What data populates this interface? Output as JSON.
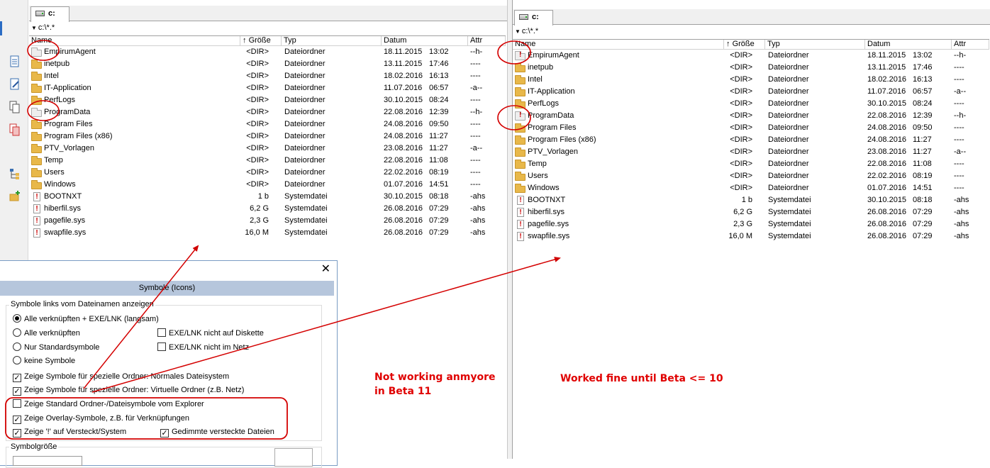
{
  "left_panel": {
    "tab_label": "c:",
    "path": "c:\\*.*",
    "columns": {
      "name": "Name",
      "size": "Größe",
      "type": "Typ",
      "date": "Datum",
      "attr": "Attr"
    },
    "rows": [
      {
        "icon": "folder-plain",
        "name": "EmpirumAgent",
        "size": "<DIR>",
        "type": "Dateiordner",
        "date": "18.11.2015",
        "time": "13:02",
        "attr": "--h-"
      },
      {
        "icon": "folder",
        "name": "inetpub",
        "size": "<DIR>",
        "type": "Dateiordner",
        "date": "13.11.2015",
        "time": "17:46",
        "attr": "----"
      },
      {
        "icon": "folder",
        "name": "Intel",
        "size": "<DIR>",
        "type": "Dateiordner",
        "date": "18.02.2016",
        "time": "16:13",
        "attr": "----"
      },
      {
        "icon": "folder",
        "name": "IT-Application",
        "size": "<DIR>",
        "type": "Dateiordner",
        "date": "11.07.2016",
        "time": "06:57",
        "attr": "-a--"
      },
      {
        "icon": "folder",
        "name": "PerfLogs",
        "size": "<DIR>",
        "type": "Dateiordner",
        "date": "30.10.2015",
        "time": "08:24",
        "attr": "----"
      },
      {
        "icon": "folder-plain",
        "name": "ProgramData",
        "size": "<DIR>",
        "type": "Dateiordner",
        "date": "22.08.2016",
        "time": "12:39",
        "attr": "--h-"
      },
      {
        "icon": "folder",
        "name": "Program Files",
        "size": "<DIR>",
        "type": "Dateiordner",
        "date": "24.08.2016",
        "time": "09:50",
        "attr": "----"
      },
      {
        "icon": "folder",
        "name": "Program Files (x86)",
        "size": "<DIR>",
        "type": "Dateiordner",
        "date": "24.08.2016",
        "time": "11:27",
        "attr": "----"
      },
      {
        "icon": "folder",
        "name": "PTV_Vorlagen",
        "size": "<DIR>",
        "type": "Dateiordner",
        "date": "23.08.2016",
        "time": "11:27",
        "attr": "-a--"
      },
      {
        "icon": "folder",
        "name": "Temp",
        "size": "<DIR>",
        "type": "Dateiordner",
        "date": "22.08.2016",
        "time": "11:08",
        "attr": "----"
      },
      {
        "icon": "folder",
        "name": "Users",
        "size": "<DIR>",
        "type": "Dateiordner",
        "date": "22.02.2016",
        "time": "08:19",
        "attr": "----"
      },
      {
        "icon": "folder",
        "name": "Windows",
        "size": "<DIR>",
        "type": "Dateiordner",
        "date": "01.07.2016",
        "time": "14:51",
        "attr": "----"
      },
      {
        "icon": "sysfile",
        "name": "BOOTNXT",
        "size": "1 b",
        "type": "Systemdatei",
        "date": "30.10.2015",
        "time": "08:18",
        "attr": "-ahs"
      },
      {
        "icon": "sysfile",
        "name": "hiberfil.sys",
        "size": "6,2 G",
        "type": "Systemdatei",
        "date": "26.08.2016",
        "time": "07:29",
        "attr": "-ahs"
      },
      {
        "icon": "sysfile",
        "name": "pagefile.sys",
        "size": "2,3 G",
        "type": "Systemdatei",
        "date": "26.08.2016",
        "time": "07:29",
        "attr": "-ahs"
      },
      {
        "icon": "sysfile",
        "name": "swapfile.sys",
        "size": "16,0 M",
        "type": "Systemdatei",
        "date": "26.08.2016",
        "time": "07:29",
        "attr": "-ahs"
      }
    ]
  },
  "right_panel": {
    "tab_label": "c:",
    "path": "c:\\*.*",
    "columns": {
      "name": "Name",
      "size": "Größe",
      "type": "Typ",
      "date": "Datum",
      "attr": "Attr"
    },
    "rows": [
      {
        "icon": "folder-plain-excl",
        "name": "EmpirumAgent",
        "size": "<DIR>",
        "type": "Dateiordner",
        "date": "18.11.2015",
        "time": "13:02",
        "attr": "--h-"
      },
      {
        "icon": "folder",
        "name": "inetpub",
        "size": "<DIR>",
        "type": "Dateiordner",
        "date": "13.11.2015",
        "time": "17:46",
        "attr": "----"
      },
      {
        "icon": "folder",
        "name": "Intel",
        "size": "<DIR>",
        "type": "Dateiordner",
        "date": "18.02.2016",
        "time": "16:13",
        "attr": "----"
      },
      {
        "icon": "folder",
        "name": "IT-Application",
        "size": "<DIR>",
        "type": "Dateiordner",
        "date": "11.07.2016",
        "time": "06:57",
        "attr": "-a--"
      },
      {
        "icon": "folder",
        "name": "PerfLogs",
        "size": "<DIR>",
        "type": "Dateiordner",
        "date": "30.10.2015",
        "time": "08:24",
        "attr": "----"
      },
      {
        "icon": "folder-plain-excl",
        "name": "ProgramData",
        "size": "<DIR>",
        "type": "Dateiordner",
        "date": "22.08.2016",
        "time": "12:39",
        "attr": "--h-"
      },
      {
        "icon": "folder",
        "name": "Program Files",
        "size": "<DIR>",
        "type": "Dateiordner",
        "date": "24.08.2016",
        "time": "09:50",
        "attr": "----"
      },
      {
        "icon": "folder",
        "name": "Program Files (x86)",
        "size": "<DIR>",
        "type": "Dateiordner",
        "date": "24.08.2016",
        "time": "11:27",
        "attr": "----"
      },
      {
        "icon": "folder",
        "name": "PTV_Vorlagen",
        "size": "<DIR>",
        "type": "Dateiordner",
        "date": "23.08.2016",
        "time": "11:27",
        "attr": "-a--"
      },
      {
        "icon": "folder",
        "name": "Temp",
        "size": "<DIR>",
        "type": "Dateiordner",
        "date": "22.08.2016",
        "time": "11:08",
        "attr": "----"
      },
      {
        "icon": "folder",
        "name": "Users",
        "size": "<DIR>",
        "type": "Dateiordner",
        "date": "22.02.2016",
        "time": "08:19",
        "attr": "----"
      },
      {
        "icon": "folder",
        "name": "Windows",
        "size": "<DIR>",
        "type": "Dateiordner",
        "date": "01.07.2016",
        "time": "14:51",
        "attr": "----"
      },
      {
        "icon": "sysfile",
        "name": "BOOTNXT",
        "size": "1 b",
        "type": "Systemdatei",
        "date": "30.10.2015",
        "time": "08:18",
        "attr": "-ahs"
      },
      {
        "icon": "sysfile",
        "name": "hiberfil.sys",
        "size": "6,2 G",
        "type": "Systemdatei",
        "date": "26.08.2016",
        "time": "07:29",
        "attr": "-ahs"
      },
      {
        "icon": "sysfile",
        "name": "pagefile.sys",
        "size": "2,3 G",
        "type": "Systemdatei",
        "date": "26.08.2016",
        "time": "07:29",
        "attr": "-ahs"
      },
      {
        "icon": "sysfile",
        "name": "swapfile.sys",
        "size": "16,0 M",
        "type": "Systemdatei",
        "date": "26.08.2016",
        "time": "07:29",
        "attr": "-ahs"
      }
    ]
  },
  "dialog": {
    "close_glyph": "✕",
    "title": "Symbole (Icons)",
    "group_title": "Symbole links vom Dateinamen anzeigen",
    "radios": [
      {
        "label": "Alle verknüpften + EXE/LNK (langsam)",
        "checked": true
      },
      {
        "label": "Alle verknüpften",
        "checked": false
      },
      {
        "label": "Nur Standardsymbole",
        "checked": false
      },
      {
        "label": "keine Symbole",
        "checked": false
      }
    ],
    "checks_right": [
      {
        "label": "EXE/LNK nicht auf Diskette",
        "checked": false
      },
      {
        "label": "EXE/LNK nicht im Netz",
        "checked": false
      }
    ],
    "checks": [
      {
        "label": "Zeige Symbole für spezielle Ordner: Normales Dateisystem",
        "checked": true
      },
      {
        "label": "Zeige Symbole für spezielle Ordner: Virtuelle Ordner (z.B. Netz)",
        "checked": true
      },
      {
        "label": "Zeige Standard Ordner-/Dateisymbole vom Explorer",
        "checked": false
      },
      {
        "label": "Zeige Overlay-Symbole, z.B. für Verknüpfungen",
        "checked": true
      },
      {
        "label": "Zeige '!' auf Versteckt/System",
        "checked": true
      },
      {
        "label": "Gedimmte versteckte Dateien",
        "checked": true
      }
    ],
    "size_group_title": "Symbolgröße"
  },
  "annotations": {
    "left_note": "Not working anmyore\nin Beta 11",
    "right_note": "Worked fine until Beta <= 10",
    "color": "#e00000"
  }
}
